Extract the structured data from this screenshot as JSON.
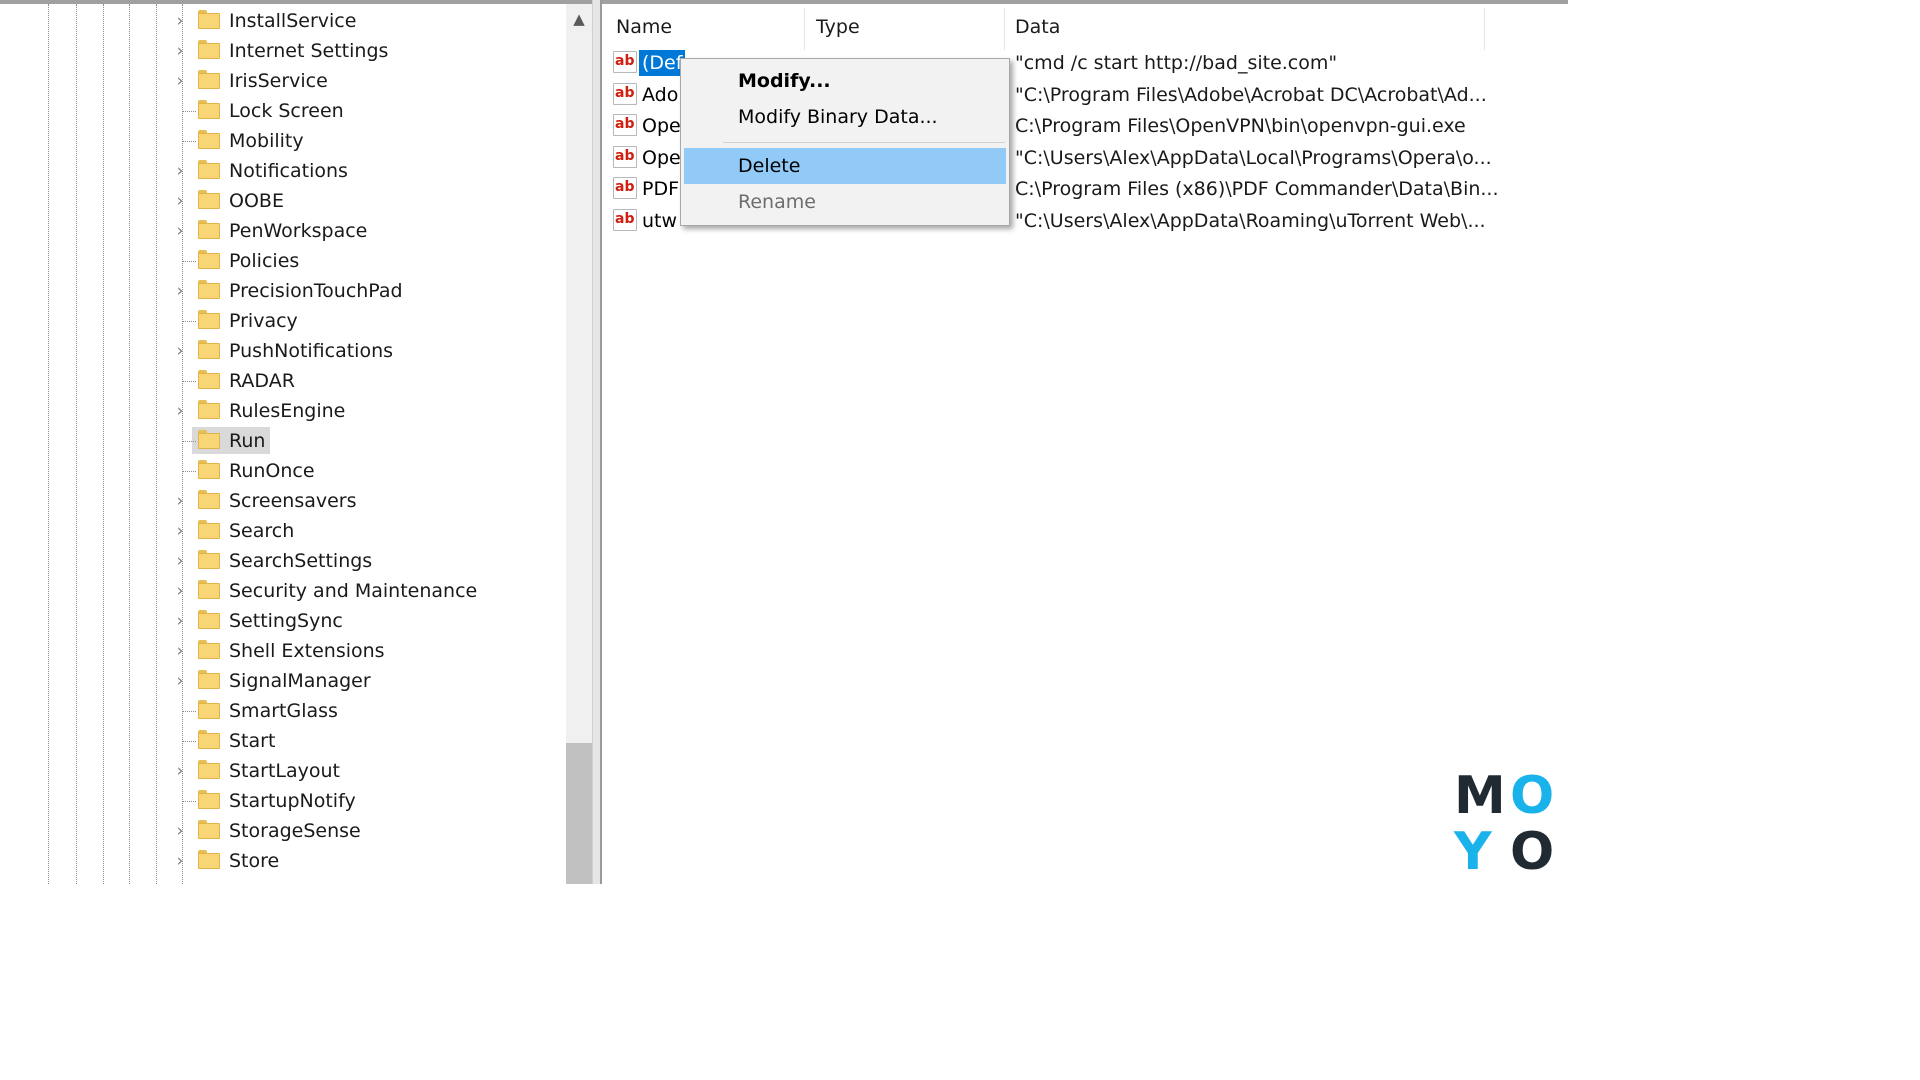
{
  "tree": {
    "items": [
      {
        "label": "InstallService",
        "expandable": true
      },
      {
        "label": "Internet Settings",
        "expandable": true
      },
      {
        "label": "IrisService",
        "expandable": true
      },
      {
        "label": "Lock Screen",
        "expandable": false
      },
      {
        "label": "Mobility",
        "expandable": false
      },
      {
        "label": "Notifications",
        "expandable": true
      },
      {
        "label": "OOBE",
        "expandable": true
      },
      {
        "label": "PenWorkspace",
        "expandable": true
      },
      {
        "label": "Policies",
        "expandable": false
      },
      {
        "label": "PrecisionTouchPad",
        "expandable": true
      },
      {
        "label": "Privacy",
        "expandable": false
      },
      {
        "label": "PushNotifications",
        "expandable": true
      },
      {
        "label": "RADAR",
        "expandable": false
      },
      {
        "label": "RulesEngine",
        "expandable": true
      },
      {
        "label": "Run",
        "expandable": false,
        "selected": true
      },
      {
        "label": "RunOnce",
        "expandable": false
      },
      {
        "label": "Screensavers",
        "expandable": true
      },
      {
        "label": "Search",
        "expandable": true
      },
      {
        "label": "SearchSettings",
        "expandable": true
      },
      {
        "label": "Security and Maintenance",
        "expandable": true
      },
      {
        "label": "SettingSync",
        "expandable": true
      },
      {
        "label": "Shell Extensions",
        "expandable": true
      },
      {
        "label": "SignalManager",
        "expandable": true
      },
      {
        "label": "SmartGlass",
        "expandable": false
      },
      {
        "label": "Start",
        "expandable": false
      },
      {
        "label": "StartLayout",
        "expandable": true
      },
      {
        "label": "StartupNotify",
        "expandable": false
      },
      {
        "label": "StorageSense",
        "expandable": true
      },
      {
        "label": "Store",
        "expandable": true
      }
    ]
  },
  "list": {
    "columns": {
      "name": "Name",
      "type": "Type",
      "data": "Data"
    },
    "rows": [
      {
        "name": "(Def",
        "type": "",
        "data": "\"cmd /c start http://bad_site.com\"",
        "selected": true
      },
      {
        "name": "Ado",
        "type": "",
        "data": "\"C:\\Program Files\\Adobe\\Acrobat DC\\Acrobat\\Ad..."
      },
      {
        "name": "Ope",
        "type": "",
        "data": "C:\\Program Files\\OpenVPN\\bin\\openvpn-gui.exe"
      },
      {
        "name": "Ope",
        "type": "",
        "data": "\"C:\\Users\\Alex\\AppData\\Local\\Programs\\Opera\\o..."
      },
      {
        "name": "PDF",
        "type": "",
        "data": "C:\\Program Files (x86)\\PDF Commander\\Data\\Bin..."
      },
      {
        "name": "utw",
        "type": "",
        "data": "\"C:\\Users\\Alex\\AppData\\Roaming\\uTorrent Web\\..."
      }
    ],
    "icon_text": "ab"
  },
  "context_menu": {
    "modify": "Modify...",
    "modify_binary": "Modify Binary Data...",
    "delete": "Delete",
    "rename": "Rename"
  },
  "logo": {
    "letters": [
      "M",
      "O",
      "Y",
      "O"
    ],
    "colors": {
      "dark": "#1f2a33",
      "accent": "#1ab2ea"
    }
  },
  "colors": {
    "selection": "#0078d7",
    "menu_highlight": "#91c9f7",
    "folder": "#f9d675"
  }
}
